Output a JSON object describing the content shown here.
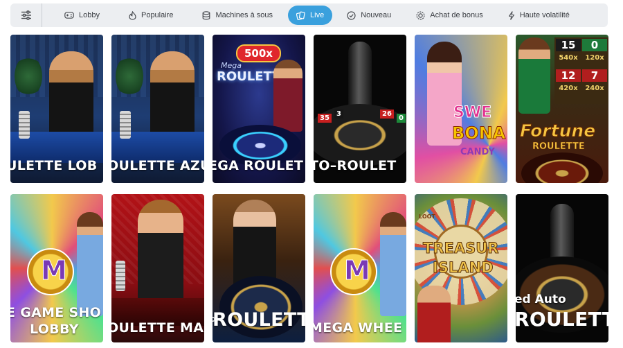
{
  "nav": {
    "tabs": [
      {
        "label": "Lobby",
        "icon": "gamepad-icon"
      },
      {
        "label": "Populaire",
        "icon": "flame-icon"
      },
      {
        "label": "Machines à sous",
        "icon": "coin-stack-icon"
      },
      {
        "label": "Live",
        "icon": "cards-icon"
      },
      {
        "label": "Nouveau",
        "icon": "check-circle-icon"
      },
      {
        "label": "Achat de bonus",
        "icon": "gear-badge-icon"
      },
      {
        "label": "Haute volatilité",
        "icon": "lightning-icon"
      }
    ],
    "active_tab": "Live",
    "accent_color": "#3aa0dd"
  },
  "games": [
    {
      "title": "ULETTE LOB"
    },
    {
      "title": "OULETTE AZU"
    },
    {
      "title": "EGA ROULET",
      "badge": "500x",
      "logo_line1": "Mega",
      "logo_line2": "ROULETTE"
    },
    {
      "title": "TO–ROULET",
      "wheel_numbers": [
        "35",
        "3",
        "26",
        "0"
      ]
    },
    {
      "logo_line1": "SWE",
      "logo_line2": "BONA",
      "logo_line3": "CANDY"
    },
    {
      "logo_line1": "Fortune",
      "logo_line2": "ROULETTE",
      "multipliers": [
        "15",
        "0",
        "540x",
        "120x",
        "12",
        "7",
        "420x",
        "240x"
      ]
    },
    {
      "title": "E GAME SHO",
      "title2": "LOBBY",
      "logo_line1": "M"
    },
    {
      "title": "OULETTE MAC"
    },
    {
      "title": "ROULETT",
      "prefix": "O"
    },
    {
      "title": "MEGA WHEE",
      "logo_line1": "M"
    },
    {
      "logo_line1": "TREASUR",
      "logo_line2": "ISLAND",
      "segment_label": "LOOT"
    },
    {
      "title": "ROULETTE",
      "title_small": "ed Auto"
    }
  ]
}
